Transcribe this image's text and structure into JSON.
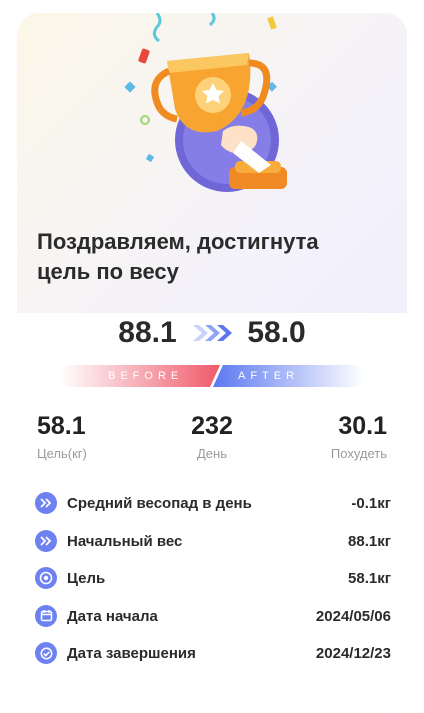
{
  "header": {
    "title_line1": "Поздравляем, достигнута",
    "title_line2": "цель по весу"
  },
  "progress": {
    "before_weight": "88.1",
    "after_weight": "58.0",
    "before_label": "BEFORE",
    "after_label": "AFTER"
  },
  "stats": [
    {
      "value": "58.1",
      "label": "Цель(кг)"
    },
    {
      "value": "232",
      "label": "День"
    },
    {
      "value": "30.1",
      "label": "Похудеть"
    }
  ],
  "details": [
    {
      "icon": "double-chevron-icon",
      "label": "Средний весопад в день",
      "value": "-0.1кг"
    },
    {
      "icon": "double-chevron-icon",
      "label": "Начальный вес",
      "value": "88.1кг"
    },
    {
      "icon": "target-icon",
      "label": "Цель",
      "value": "58.1кг"
    },
    {
      "icon": "calendar-icon",
      "label": "Дата начала",
      "value": "2024/05/06"
    },
    {
      "icon": "check-circle-icon",
      "label": "Дата завершения",
      "value": "2024/12/23"
    }
  ],
  "colors": {
    "accent": "#6d82f0",
    "before": "#ef5a6a",
    "after": "#5b78f0",
    "trophy": "#f7a530"
  }
}
